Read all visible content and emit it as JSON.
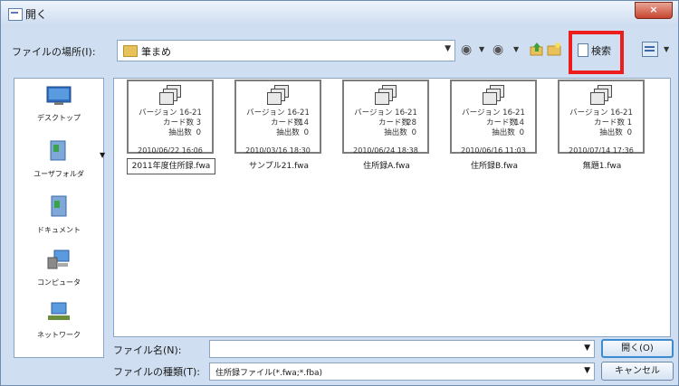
{
  "window": {
    "title": "開く",
    "close_label": "×"
  },
  "toolbar": {
    "look_in_label": "ファイルの場所(I):",
    "look_in_value": "筆まめ",
    "search_label": "検索"
  },
  "places": [
    {
      "label": "デスクトップ",
      "icon": "desktop-icon"
    },
    {
      "label": "ユーザフォルダ",
      "icon": "user-folder-icon"
    },
    {
      "label": "ドキュメント",
      "icon": "documents-icon"
    },
    {
      "label": "コンピュータ",
      "icon": "computer-icon"
    },
    {
      "label": "ネットワーク",
      "icon": "network-icon"
    }
  ],
  "stat_labels": {
    "version": "バージョン 16-21",
    "cards": "カード数",
    "extracted": "抽出数"
  },
  "files": [
    {
      "cards": "3",
      "extracted": "0",
      "date": "2010/06/22 16:06",
      "name": "2011年度住所録.fwa",
      "selected": true
    },
    {
      "cards": "14",
      "extracted": "0",
      "date": "2010/03/16 18:30",
      "name": "サンプル21.fwa",
      "selected": false
    },
    {
      "cards": "28",
      "extracted": "0",
      "date": "2010/06/24 18:38",
      "name": "住所録A.fwa",
      "selected": false
    },
    {
      "cards": "14",
      "extracted": "0",
      "date": "2010/06/16 11:03",
      "name": "住所録B.fwa",
      "selected": false
    },
    {
      "cards": "1",
      "extracted": "0",
      "date": "2010/07/14 17:36",
      "name": "無題1.fwa",
      "selected": false
    }
  ],
  "bottom": {
    "filename_label": "ファイル名(N):",
    "filename_value": "",
    "filetype_label": "ファイルの種類(T):",
    "filetype_value": "住所録ファイル(*.fwa;*.fba)",
    "open_label": "開く(O)",
    "cancel_label": "キャンセル"
  },
  "colors": {
    "highlight": "#ee1d1d",
    "window_bg": "#cfdef0"
  }
}
